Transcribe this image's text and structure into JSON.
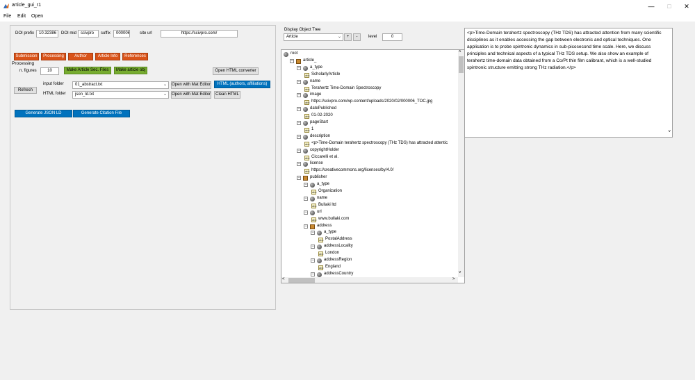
{
  "window": {
    "title": "article_gui_r1"
  },
  "menu": [
    "File",
    "Edit",
    "Open"
  ],
  "doi": {
    "prefix_label": "DOI prefix",
    "prefix_value": "10.32386",
    "mid_label": "DOI mid",
    "mid_value": "scivpro",
    "suffix_label": "suffix",
    "suffix_value": "000006",
    "site_url_label": "site url",
    "site_url_value": "https://scivpro.com/"
  },
  "tabs": [
    "Submission",
    "Processing",
    "Author",
    "Article Info",
    "References"
  ],
  "processing": {
    "section_label": "Processing",
    "n_figures_label": "n. figures",
    "n_figures_value": "10",
    "make_sec_files": "Make Article Sec. Files",
    "make_article_obj": "Make article obj",
    "open_html_converter": "Open HTML converter",
    "refresh": "Refresh",
    "input_folder_label": "input folder",
    "input_folder_value": "01_abstract.txt",
    "html_folder_label": "HTML folder",
    "html_folder_value": "json_ld.txt",
    "open_mat_editor_1": "Open with Mat Editor",
    "open_mat_editor_2": "Open with Mat Editor",
    "html_authors": "HTML (authors, affiliations)",
    "clean_html": "Clean HTML",
    "generate_json_ld": "Generate JSON LD",
    "generate_citation": "Generate Citation File"
  },
  "tree_controls": {
    "label": "Display Object Tree",
    "selected": "Article",
    "plus": "+",
    "minus": "-",
    "level_label": "level",
    "level_value": "0"
  },
  "tree": [
    {
      "level": 0,
      "icon": "obj",
      "label": "root",
      "exp": false
    },
    {
      "level": 1,
      "icon": "struct",
      "label": "article_",
      "exp": true
    },
    {
      "level": 2,
      "icon": "obj",
      "label": "a_type",
      "exp": true
    },
    {
      "level": 3,
      "icon": "str",
      "label": "ScholarlyArticle",
      "exp": false
    },
    {
      "level": 2,
      "icon": "obj",
      "label": "name",
      "exp": true
    },
    {
      "level": 3,
      "icon": "str",
      "label": "Terahertz Time-Domain Spectroscopy",
      "exp": false
    },
    {
      "level": 2,
      "icon": "obj",
      "label": "image",
      "exp": true
    },
    {
      "level": 3,
      "icon": "str",
      "label": "https://scivpro.com/wp-content/uploads/2020/02/000006_TOC.jpg",
      "exp": false
    },
    {
      "level": 2,
      "icon": "obj",
      "label": "datePublished",
      "exp": true
    },
    {
      "level": 3,
      "icon": "str",
      "label": "01-02-2020",
      "exp": false
    },
    {
      "level": 2,
      "icon": "obj",
      "label": "pageStart",
      "exp": true
    },
    {
      "level": 3,
      "icon": "str",
      "label": "1",
      "exp": false
    },
    {
      "level": 2,
      "icon": "obj",
      "label": "description",
      "exp": true
    },
    {
      "level": 3,
      "icon": "str",
      "label": "<p>Time-Domain terahertz spectroscopy (THz TDS) has attracted attentic",
      "exp": false
    },
    {
      "level": 2,
      "icon": "obj",
      "label": "copyrightHolder",
      "exp": true
    },
    {
      "level": 3,
      "icon": "str",
      "label": "Ciccarelli et al.",
      "exp": false
    },
    {
      "level": 2,
      "icon": "obj",
      "label": "license",
      "exp": true
    },
    {
      "level": 3,
      "icon": "str",
      "label": "https://creativecommons.org/licenses/by/4.0/",
      "exp": false
    },
    {
      "level": 2,
      "icon": "struct",
      "label": "publisher",
      "exp": true
    },
    {
      "level": 3,
      "icon": "obj",
      "label": "a_type",
      "exp": true
    },
    {
      "level": 4,
      "icon": "str",
      "label": "Organization",
      "exp": false
    },
    {
      "level": 3,
      "icon": "obj",
      "label": "name",
      "exp": true
    },
    {
      "level": 4,
      "icon": "str",
      "label": "Bullaki ltd",
      "exp": false
    },
    {
      "level": 3,
      "icon": "obj",
      "label": "url",
      "exp": true
    },
    {
      "level": 4,
      "icon": "str",
      "label": "www.bullaki.com",
      "exp": false
    },
    {
      "level": 3,
      "icon": "struct",
      "label": "address",
      "exp": true
    },
    {
      "level": 4,
      "icon": "obj",
      "label": "a_type",
      "exp": true
    },
    {
      "level": 5,
      "icon": "str",
      "label": "PostalAddress",
      "exp": false
    },
    {
      "level": 4,
      "icon": "obj",
      "label": "addressLocality",
      "exp": true
    },
    {
      "level": 5,
      "icon": "str",
      "label": "London",
      "exp": false
    },
    {
      "level": 4,
      "icon": "obj",
      "label": "addressRegion",
      "exp": true
    },
    {
      "level": 5,
      "icon": "str",
      "label": "England",
      "exp": false
    },
    {
      "level": 4,
      "icon": "obj",
      "label": "addressCountry",
      "exp": true
    }
  ],
  "description_text": "<p>Time-Domain terahertz spectroscopy (THz TDS) has attracted attention from many scientific disciplines as it enables accessing the gap between electronic and optical techniques. One application is to probe spintronic dynamics in sub-picosecond time scale. Here, we discuss principles and technical aspects of a typical THz TDS setup. We also show an example of terahertz time-domain data obtained from a Co/Pt thin film calibrant, which is a well-studied spintronic structure emitting strong THz radiation.</p>",
  "str_icon_text": "abc",
  "colors": {
    "tab_orange": "#d95319",
    "button_green": "#77ac30",
    "button_blue": "#0072bd"
  }
}
